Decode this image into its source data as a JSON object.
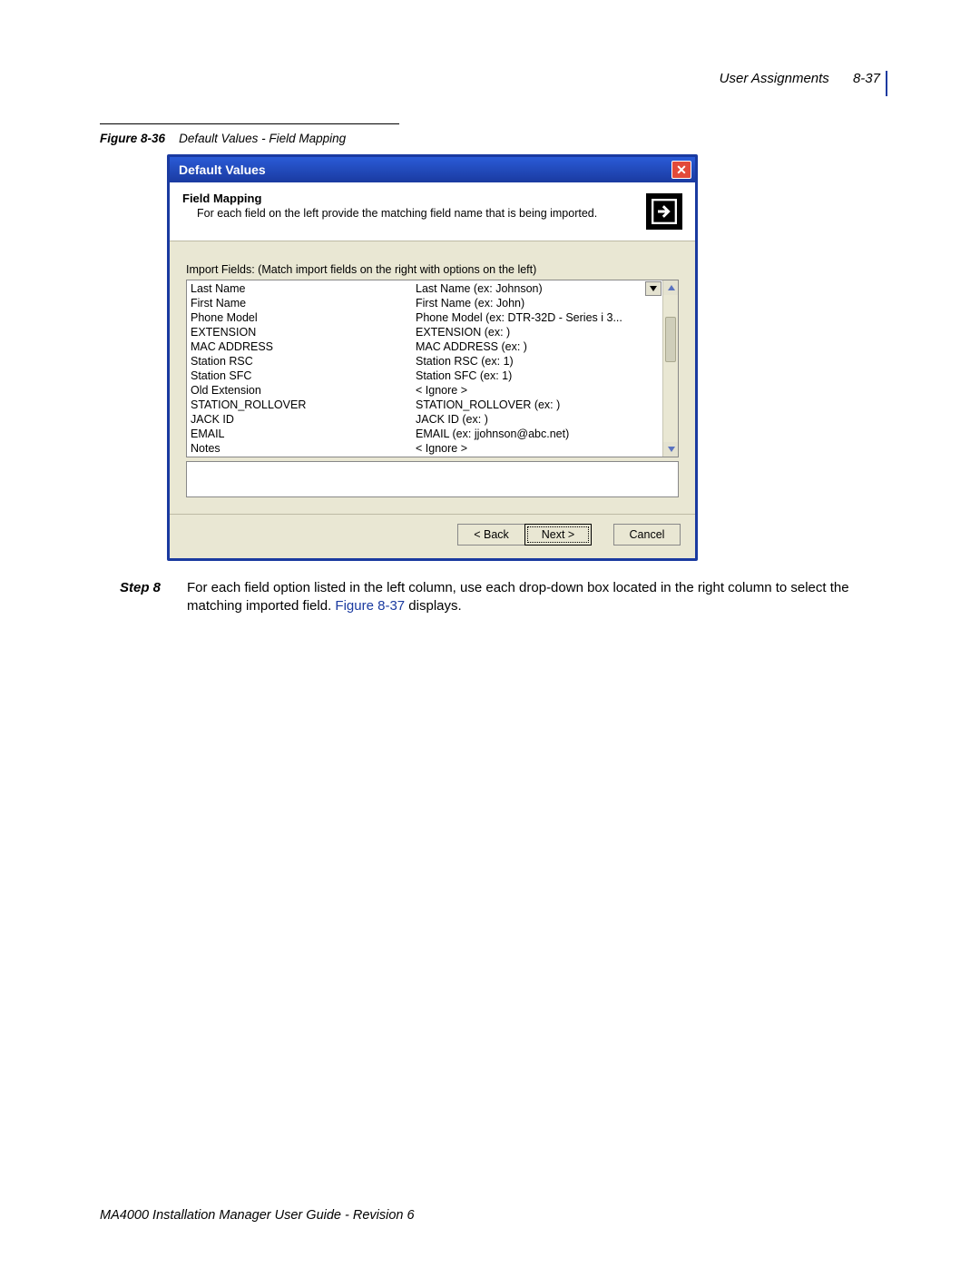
{
  "header": {
    "section_title": "User Assignments",
    "page_number": "8-37"
  },
  "figure": {
    "number": "Figure 8-36",
    "title": "Default Values - Field Mapping"
  },
  "dialog": {
    "title": "Default Values",
    "wizard_head_title": "Field Mapping",
    "wizard_head_desc": "For each field on the left provide the matching field name that is being imported.",
    "import_label": "Import Fields: (Match import fields on the right with options on the left)",
    "rows": [
      {
        "left": "Last Name",
        "right": "Last Name (ex: Johnson)"
      },
      {
        "left": "First Name",
        "right": "First Name (ex: John)"
      },
      {
        "left": "Phone Model",
        "right": "Phone Model (ex: DTR-32D  - Series i  3..."
      },
      {
        "left": "EXTENSION",
        "right": "EXTENSION (ex: )"
      },
      {
        "left": "MAC ADDRESS",
        "right": "MAC ADDRESS (ex: )"
      },
      {
        "left": "Station RSC",
        "right": "Station RSC (ex: 1)"
      },
      {
        "left": "Station SFC",
        "right": "Station SFC (ex: 1)"
      },
      {
        "left": "Old Extension",
        "right": "< Ignore >"
      },
      {
        "left": "STATION_ROLLOVER",
        "right": "STATION_ROLLOVER (ex: )"
      },
      {
        "left": "JACK ID",
        "right": "JACK ID (ex: )"
      },
      {
        "left": "EMAIL",
        "right": "EMAIL (ex: jjohnson@abc.net)"
      },
      {
        "left": "Notes",
        "right": "< Ignore >"
      }
    ],
    "buttons": {
      "back": "< Back",
      "next": "Next >",
      "cancel": "Cancel"
    }
  },
  "step": {
    "label": "Step  8",
    "text_1": "For each field option listed in the left column, use each drop-down box located in the right column to select the matching imported field. ",
    "figref": "Figure 8-37",
    "text_2": " displays."
  },
  "footer": "MA4000 Installation Manager User Guide - Revision 6"
}
